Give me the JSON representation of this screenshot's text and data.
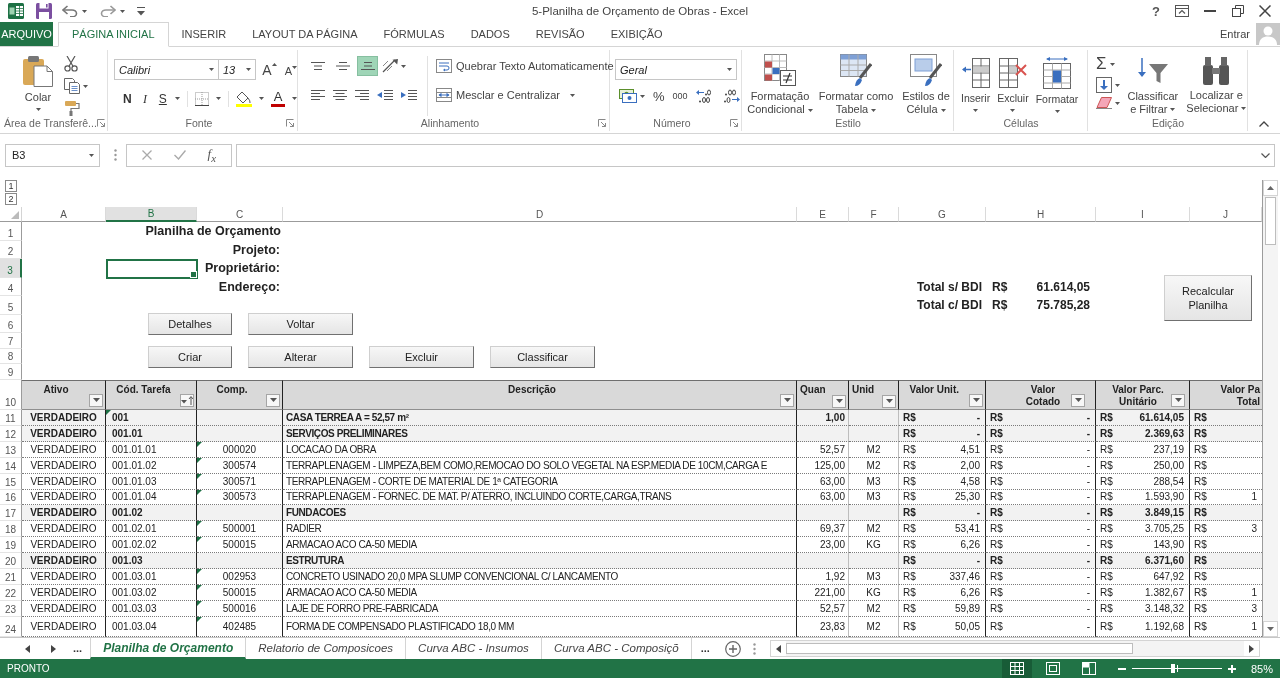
{
  "title_bar": {
    "title": "5-Planilha de Orçamento de Obras - Excel",
    "help": "?"
  },
  "ribbon_tabs": [
    {
      "label": "ARQUIVO",
      "kind": "file",
      "selected": false
    },
    {
      "label": "PÁGINA INICIAL",
      "kind": "tab",
      "selected": true
    },
    {
      "label": "INSERIR",
      "kind": "tab",
      "selected": false
    },
    {
      "label": "LAYOUT DA PÁGINA",
      "kind": "tab",
      "selected": false
    },
    {
      "label": "FÓRMULAS",
      "kind": "tab",
      "selected": false
    },
    {
      "label": "DADOS",
      "kind": "tab",
      "selected": false
    },
    {
      "label": "REVISÃO",
      "kind": "tab",
      "selected": false
    },
    {
      "label": "EXIBIÇÃO",
      "kind": "tab",
      "selected": false
    }
  ],
  "account": {
    "label": "Entrar"
  },
  "ribbon": {
    "clipboard": {
      "paste": "Colar",
      "label": "Área de Transferê..."
    },
    "font": {
      "name": "Calibri",
      "size": "13",
      "grow": "A",
      "shrink": "A",
      "bold": "N",
      "italic": "I",
      "underline": "S",
      "font_color": "A",
      "label": "Fonte"
    },
    "alignment": {
      "vertical": [
        {
          "selected": false
        },
        {
          "selected": false
        },
        {
          "selected": true
        }
      ],
      "wrap": "Quebrar Texto Automaticamente",
      "merge": "Mesclar e Centralizar",
      "label": "Alinhamento"
    },
    "number": {
      "format": "Geral",
      "percent": "%",
      "thousands": "000",
      "label": "Número"
    },
    "styles": {
      "buttons": [
        "Formatação Condicional",
        "Formatar como Tabela",
        "Estilos de Célula"
      ],
      "label": "Estilo"
    },
    "cells": {
      "buttons": [
        "Inserir",
        "Excluir",
        "Formatar"
      ],
      "label": "Células"
    },
    "editing": {
      "autosum": "Σ",
      "buttons": [
        "Classificar e Filtrar",
        "Localizar e Selecionar"
      ],
      "label": "Edição"
    }
  },
  "formula_bar": {
    "name_box": "B3",
    "function_button": "f$_{x}$"
  },
  "outline_levels": [
    "1",
    "2"
  ],
  "sheet": {
    "column_letters": [
      {
        "label": "A",
        "selected": false
      },
      {
        "label": "B",
        "selected": true
      },
      {
        "label": "C",
        "selected": false
      },
      {
        "label": "D",
        "selected": false
      },
      {
        "label": "E",
        "selected": false
      },
      {
        "label": "F",
        "selected": false
      },
      {
        "label": "G",
        "selected": false
      },
      {
        "label": "H",
        "selected": false
      },
      {
        "label": "I",
        "selected": false
      },
      {
        "label": "J",
        "selected": false
      }
    ],
    "row_numbers": [
      {
        "label": "1",
        "selected": false
      },
      {
        "label": "2",
        "selected": false
      },
      {
        "label": "3",
        "selected": true
      },
      {
        "label": "4",
        "selected": false
      },
      {
        "label": "5",
        "selected": false
      },
      {
        "label": "6",
        "selected": false
      },
      {
        "label": "7",
        "selected": false
      },
      {
        "label": "8",
        "selected": false
      },
      {
        "label": "9",
        "selected": false
      },
      {
        "label": "10",
        "selected": false
      },
      {
        "label": "11",
        "selected": false
      },
      {
        "label": "12",
        "selected": false
      },
      {
        "label": "13",
        "selected": false
      },
      {
        "label": "14",
        "selected": false
      },
      {
        "label": "15",
        "selected": false
      },
      {
        "label": "16",
        "selected": false
      },
      {
        "label": "17",
        "selected": false
      },
      {
        "label": "18",
        "selected": false
      },
      {
        "label": "19",
        "selected": false
      },
      {
        "label": "20",
        "selected": false
      },
      {
        "label": "21",
        "selected": false
      },
      {
        "label": "22",
        "selected": false
      },
      {
        "label": "23",
        "selected": false
      },
      {
        "label": "24",
        "selected": false
      }
    ],
    "title": "Planilha de Orçamento",
    "fields": [
      "Projeto:",
      "Proprietário:",
      "Endereço:"
    ],
    "totals": [
      {
        "label": "Total s/ BDI",
        "currency": "R$",
        "value": "61.614,05"
      },
      {
        "label": "Total c/ BDI",
        "currency": "R$",
        "value": "75.785,28"
      }
    ],
    "button_rows": [
      {
        "buttons": [
          "Detalhes",
          "Voltar"
        ]
      },
      {
        "buttons": [
          "Criar",
          "Alterar",
          "Excluir",
          "Classificar"
        ]
      }
    ],
    "recalc_button": "Recalcular Planilha",
    "columns": [
      {
        "label": "Ativo",
        "kind": "filter"
      },
      {
        "label": "Cód. Tarefa",
        "kind": "sorted"
      },
      {
        "label": "Comp.",
        "kind": "filter"
      },
      {
        "label": "Descrição",
        "kind": "filter"
      },
      {
        "label": "Quan",
        "kind": "filter"
      },
      {
        "label": "Unid",
        "kind": "filter"
      },
      {
        "label": "Valor Unit.",
        "kind": "filter"
      },
      {
        "label": "Valor Cotado",
        "kind": "filter"
      },
      {
        "label": "Valor Parc. Unitário",
        "kind": "filter"
      },
      {
        "label": "Valor Pa Total",
        "kind": "label_only"
      }
    ],
    "rows": [
      {
        "kind": "group",
        "ativo": "VERDADEIRO",
        "cod": "001",
        "desc": "CASA TERREA A = 52,57 m²",
        "quant": "1,00",
        "vu": [
          "R$",
          "-"
        ],
        "vc": [
          "R$",
          "-"
        ],
        "vpu": [
          "R$",
          "61.614,05"
        ],
        "vpt": [
          "R$"
        ],
        "cod_error": true,
        "comp_error": false
      },
      {
        "kind": "group",
        "ativo": "VERDADEIRO",
        "cod": "001.01",
        "desc": "SERVIÇOS PRELIMINARES",
        "vu": [
          "R$",
          "-"
        ],
        "vc": [
          "R$",
          "-"
        ],
        "vpu": [
          "R$",
          "2.369,63"
        ],
        "vpt": [
          "R$"
        ],
        "cod_error": false,
        "comp_error": false
      },
      {
        "kind": "item",
        "ativo": "VERDADEIRO",
        "cod": "001.01.01",
        "comp": "000020",
        "desc": "LOCACAO DA OBRA",
        "quant": "52,57",
        "unid": "M2",
        "vu": [
          "R$",
          "4,51"
        ],
        "vc": [
          "R$",
          "-"
        ],
        "vpu": [
          "R$",
          "237,19"
        ],
        "vpt": [
          "R$"
        ],
        "cod_error": false,
        "comp_error": true
      },
      {
        "kind": "item",
        "ativo": "VERDADEIRO",
        "cod": "001.01.02",
        "comp": "300574",
        "desc": "TERRAPLENAGEM - LIMPEZA,BEM COMO,REMOCAO DO SOLO VEGETAL NA ESP.MEDIA DE 10CM,CARGA E",
        "quant": "125,00",
        "unid": "M2",
        "vu": [
          "R$",
          "2,00"
        ],
        "vc": [
          "R$",
          "-"
        ],
        "vpu": [
          "R$",
          "250,00"
        ],
        "vpt": [
          "R$"
        ],
        "cod_error": false,
        "comp_error": true
      },
      {
        "kind": "item",
        "ativo": "VERDADEIRO",
        "cod": "001.01.03",
        "comp": "300571",
        "desc": "TERRAPLENAGEM - CORTE DE MATERIAL DE 1ª CATEGORIA",
        "quant": "63,00",
        "unid": "M3",
        "vu": [
          "R$",
          "4,58"
        ],
        "vc": [
          "R$",
          "-"
        ],
        "vpu": [
          "R$",
          "288,54"
        ],
        "vpt": [
          "R$"
        ],
        "cod_error": false,
        "comp_error": true
      },
      {
        "kind": "item",
        "ativo": "VERDADEIRO",
        "cod": "001.01.04",
        "comp": "300573",
        "desc": "TERRAPLENAGEM - FORNEC. DE MAT. P/ ATERRO, INCLUINDO CORTE,CARGA,TRANS",
        "quant": "63,00",
        "unid": "M3",
        "vu": [
          "R$",
          "25,30"
        ],
        "vc": [
          "R$",
          "-"
        ],
        "vpu": [
          "R$",
          "1.593,90"
        ],
        "vpt": [
          "R$",
          "1"
        ],
        "cod_error": false,
        "comp_error": true
      },
      {
        "kind": "group",
        "ativo": "VERDADEIRO",
        "cod": "001.02",
        "desc": "FUNDACOES",
        "vu": [
          "R$",
          "-"
        ],
        "vc": [
          "R$",
          "-"
        ],
        "vpu": [
          "R$",
          "3.849,15"
        ],
        "vpt": [
          "R$"
        ],
        "cod_error": false,
        "comp_error": false
      },
      {
        "kind": "item",
        "ativo": "VERDADEIRO",
        "cod": "001.02.01",
        "comp": "500001",
        "desc": "RADIER",
        "quant": "69,37",
        "unid": "M2",
        "vu": [
          "R$",
          "53,41"
        ],
        "vc": [
          "R$",
          "-"
        ],
        "vpu": [
          "R$",
          "3.705,25"
        ],
        "vpt": [
          "R$",
          "3"
        ],
        "cod_error": false,
        "comp_error": true
      },
      {
        "kind": "item",
        "ativo": "VERDADEIRO",
        "cod": "001.02.02",
        "comp": "500015",
        "desc": "ARMACAO ACO CA-50 MEDIA",
        "quant": "23,00",
        "unid": "KG",
        "vu": [
          "R$",
          "6,26"
        ],
        "vc": [
          "R$",
          "-"
        ],
        "vpu": [
          "R$",
          "143,90"
        ],
        "vpt": [
          "R$"
        ],
        "cod_error": false,
        "comp_error": true
      },
      {
        "kind": "group",
        "ativo": "VERDADEIRO",
        "cod": "001.03",
        "desc": "ESTRUTURA",
        "vu": [
          "R$",
          "-"
        ],
        "vc": [
          "R$",
          "-"
        ],
        "vpu": [
          "R$",
          "6.371,60"
        ],
        "vpt": [
          "R$"
        ],
        "cod_error": false,
        "comp_error": false
      },
      {
        "kind": "item",
        "ativo": "VERDADEIRO",
        "cod": "001.03.01",
        "comp": "002953",
        "desc": "CONCRETO USINADO 20,0 MPA SLUMP CONVENCIONAL C/ LANCAMENTO",
        "quant": "1,92",
        "unid": "M3",
        "vu": [
          "R$",
          "337,46"
        ],
        "vc": [
          "R$",
          "-"
        ],
        "vpu": [
          "R$",
          "647,92"
        ],
        "vpt": [
          "R$"
        ],
        "cod_error": false,
        "comp_error": true
      },
      {
        "kind": "item",
        "ativo": "VERDADEIRO",
        "cod": "001.03.02",
        "comp": "500015",
        "desc": "ARMACAO ACO CA-50 MEDIA",
        "quant": "221,00",
        "unid": "KG",
        "vu": [
          "R$",
          "6,26"
        ],
        "vc": [
          "R$",
          "-"
        ],
        "vpu": [
          "R$",
          "1.382,67"
        ],
        "vpt": [
          "R$",
          "1"
        ],
        "cod_error": false,
        "comp_error": true
      },
      {
        "kind": "item",
        "ativo": "VERDADEIRO",
        "cod": "001.03.03",
        "comp": "500016",
        "desc": "LAJE DE FORRO PRE-FABRICADA",
        "quant": "52,57",
        "unid": "M2",
        "vu": [
          "R$",
          "59,89"
        ],
        "vc": [
          "R$",
          "-"
        ],
        "vpu": [
          "R$",
          "3.148,32"
        ],
        "vpt": [
          "R$",
          "3"
        ],
        "cod_error": false,
        "comp_error": true
      },
      {
        "kind": "item",
        "ativo": "VERDADEIRO",
        "cod": "001.03.04",
        "comp": "402485",
        "desc": "FORMA DE COMPENSADO PLASTIFICADO 18,0 MM",
        "quant": "23,83",
        "unid": "M2",
        "vu": [
          "R$",
          "50,05"
        ],
        "vc": [
          "R$",
          "-"
        ],
        "vpu": [
          "R$",
          "1.192,68"
        ],
        "vpt": [
          "R$",
          "1"
        ],
        "cod_error": false,
        "comp_error": true
      }
    ]
  },
  "sheet_tabs": {
    "more_left": "...",
    "tabs": [
      {
        "label": "Planilha de Orçamento",
        "selected": true
      },
      {
        "label": "Relatorio de Composicoes",
        "selected": false
      },
      {
        "label": "Curva ABC - Insumos",
        "selected": false
      },
      {
        "label": "Curva ABC - Composiçõ",
        "selected": false
      }
    ],
    "more_right": "..."
  },
  "status_bar": {
    "status": "PRONTO",
    "views": [
      {
        "kind": "normal",
        "selected": true
      },
      {
        "kind": "page_layout",
        "selected": false
      },
      {
        "kind": "page_break",
        "selected": false
      }
    ],
    "zoom": {
      "level": 0.46,
      "reading": "85%"
    }
  }
}
